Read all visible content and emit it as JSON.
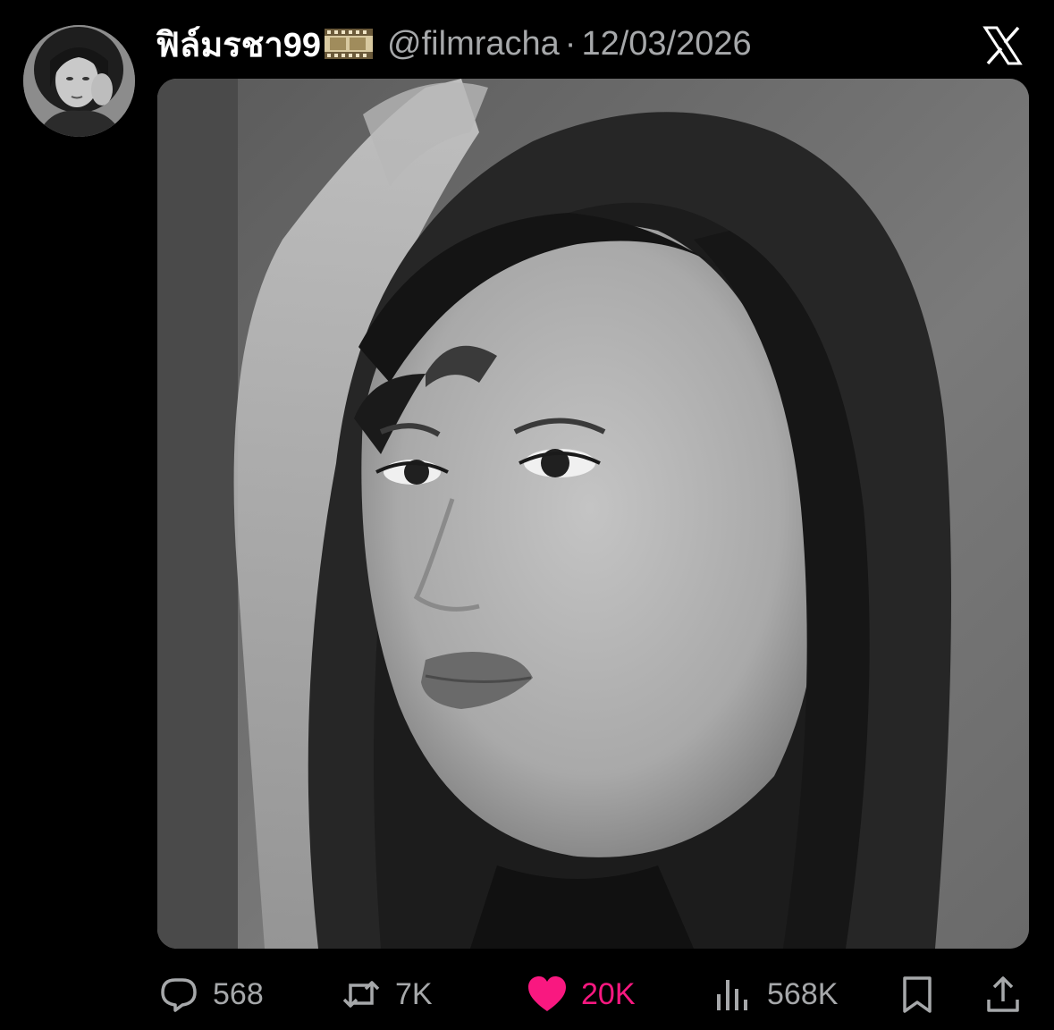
{
  "post": {
    "display_name": "ฟิล์มรชา99",
    "name_emoji_icon": "film-frames-emoji",
    "handle": "@filmracha",
    "separator": "·",
    "timestamp": "12/03/2026",
    "platform_icon": "x-logo-icon",
    "media_description_icon": "photo"
  },
  "actions": {
    "reply": {
      "icon": "reply-icon",
      "count": "568"
    },
    "repost": {
      "icon": "repost-icon",
      "count": "7K"
    },
    "like": {
      "icon": "heart-icon",
      "count": "20K",
      "active": true
    },
    "views": {
      "icon": "views-icon",
      "count": "568K"
    },
    "bookmark": {
      "icon": "bookmark-icon"
    },
    "share": {
      "icon": "share-icon"
    }
  },
  "colors": {
    "background": "#000000",
    "primary_text": "#ffffff",
    "secondary_text": "#a6a8aa",
    "like_active": "#f91880"
  }
}
